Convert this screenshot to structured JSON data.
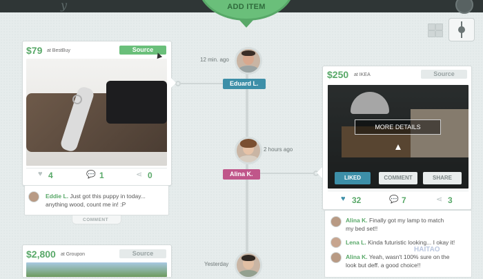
{
  "header": {
    "add_item_label": "ADD ITEM"
  },
  "timeline": {
    "entries": [
      {
        "time": "12 min. ago",
        "name": "Eduard L.",
        "color": "#3d8fa8"
      },
      {
        "time": "2 hours ago",
        "name": "Alina K.",
        "color": "#c0568a"
      },
      {
        "time": "Yesterday",
        "name": "",
        "color": "#58a868"
      }
    ]
  },
  "left_card": {
    "price": "$79",
    "store": "at BestBuy",
    "source_label": "Source",
    "likes": "4",
    "comments": "1",
    "shares": "0",
    "comment": {
      "author": "Eddie L.",
      "text_line1": "Just got this puppy in today...",
      "text_line2": "anything wood, count me in! :P"
    },
    "comment_label": "COMMENT"
  },
  "right_card": {
    "price": "$250",
    "store": "at IKEA",
    "source_label": "Source",
    "more_details": "MORE DETAILS",
    "buttons": {
      "liked": "LIKED",
      "comment": "COMMENT",
      "share": "SHARE"
    },
    "likes": "32",
    "comments": "7",
    "shares": "3",
    "comments_list": [
      {
        "author": "Alina K.",
        "line1": "Finally got my lamp to match",
        "line2": "my bed set!!"
      },
      {
        "author": "Lena L.",
        "line1": "Kinda futuristic looking... I okay it!",
        "line2": ""
      },
      {
        "author": "Alina K.",
        "line1": "Yeah, wasn't 100% sure on the",
        "line2": "look but deff. a good choice!!"
      }
    ]
  },
  "bottom_card": {
    "price": "$2,800",
    "store": "at Groupon",
    "source_label": "Source"
  },
  "watermark": {
    "text": "HAITAO"
  },
  "colors": {
    "green": "#58a868",
    "blue": "#3d8fa8",
    "pink": "#c0568a"
  }
}
